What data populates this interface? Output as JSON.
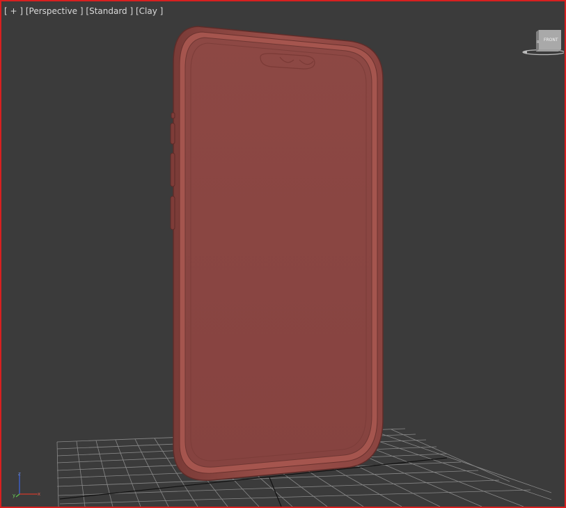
{
  "viewport": {
    "labels": {
      "plus": "[ + ]",
      "view": "[Perspective ]",
      "shading_preset": "[Standard ]",
      "shading_mode": "[Clay ]"
    },
    "active_border_color": "#d81f1f",
    "background_color": "#3b3b3b",
    "grid_color": "#8a8a8a"
  },
  "object": {
    "type": "phone-case",
    "clay_color": "#8a4642",
    "rim_color": "#9a4f49"
  },
  "viewcube": {
    "face_label": "FRONT",
    "side_label": "R"
  },
  "axis_tripod": {
    "x_label": "x",
    "y_label": "y",
    "z_label": "z",
    "x_color": "#d23a2a",
    "y_color": "#5bc24a",
    "z_color": "#3c63d6"
  }
}
